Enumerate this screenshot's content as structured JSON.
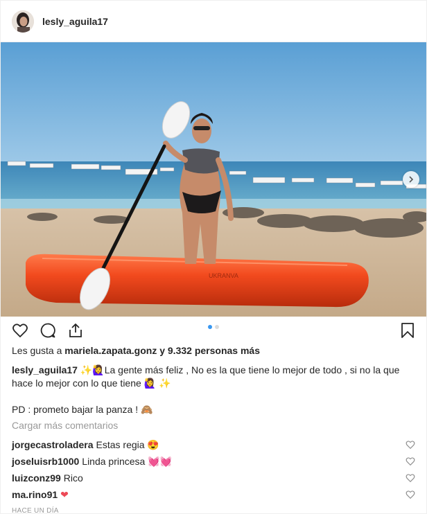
{
  "post": {
    "username": "lesly_aguila17",
    "likes_prefix": "Les gusta a",
    "likes_user": "mariela.zapata.gonz",
    "likes_suffix": "y 9.332 personas más",
    "caption_user": "lesly_aguila17",
    "caption_text": "✨🙋‍♀️La gente más feliz , No es la que tiene lo mejor de todo , si no la que hace lo mejor con lo que tiene 🙋‍♀️ ✨",
    "ps_text": "PD : prometo bajar la panza ! 🙈",
    "load_more": "Cargar más comentarios",
    "timestamp": "HACE UN DÍA",
    "carousel": {
      "count": 2,
      "active": 0
    }
  },
  "comments": [
    {
      "user": "jorgecastroladera",
      "text": "Estas regia 😍"
    },
    {
      "user": "joseluisrb1000",
      "text": "Linda princesa 💓💓"
    },
    {
      "user": "luizconz99",
      "text": "Rico"
    },
    {
      "user": "ma.rino91",
      "text": "❤"
    }
  ],
  "icons": {
    "like": "heart-outline-icon",
    "comment": "speech-bubble-icon",
    "share": "share-icon",
    "save": "bookmark-icon",
    "next": "chevron-right-icon"
  },
  "colors": {
    "accent": "#3897f0",
    "kayak": "#f24a1e",
    "heart_red": "#ed4956"
  }
}
